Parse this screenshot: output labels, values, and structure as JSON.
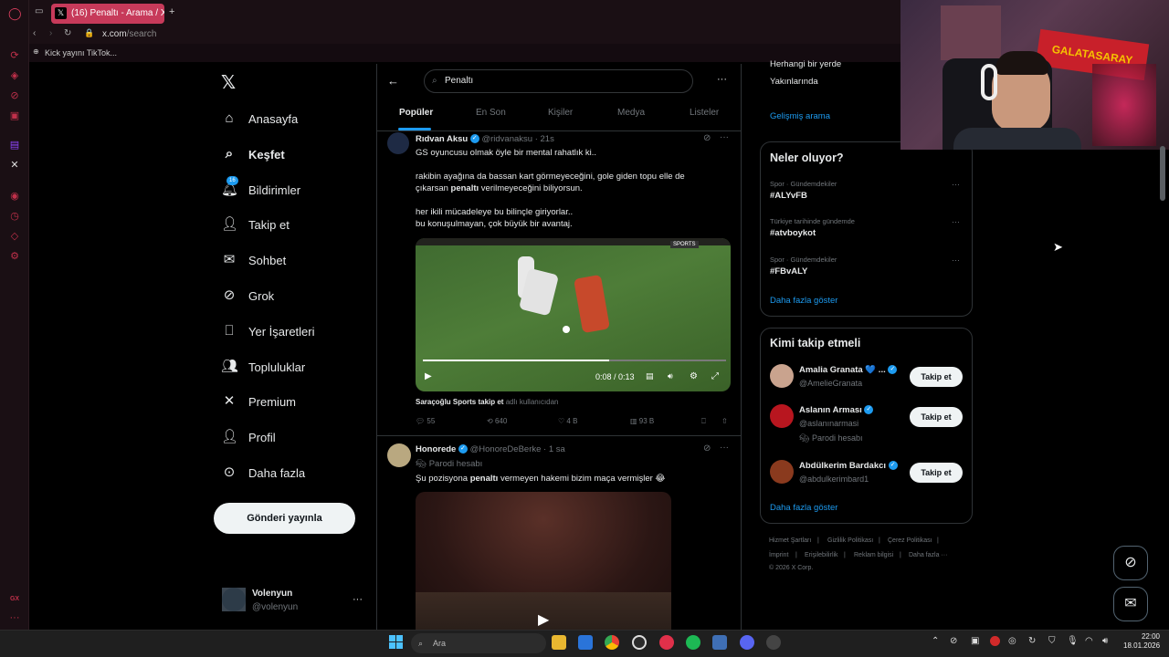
{
  "browser": {
    "tab_title": "(16) Penaltı - Arama / X",
    "tab_favicon": "𝕏",
    "new_tab": "+",
    "url_host": "x.com",
    "url_path": "/search",
    "bookmark": "Kick yayını TikTok..."
  },
  "nav": {
    "logo": "𝕏",
    "items": [
      {
        "label": "Anasayfa",
        "icon": "home-icon"
      },
      {
        "label": "Keşfet",
        "icon": "search-icon"
      },
      {
        "label": "Bildirimler",
        "icon": "bell-icon",
        "badge": "16"
      },
      {
        "label": "Takip et",
        "icon": "person-add-icon"
      },
      {
        "label": "Sohbet",
        "icon": "mail-icon"
      },
      {
        "label": "Grok",
        "icon": "grok-icon"
      },
      {
        "label": "Yer İşaretleri",
        "icon": "bookmark-icon"
      },
      {
        "label": "Topluluklar",
        "icon": "communities-icon"
      },
      {
        "label": "Premium",
        "icon": "x-icon"
      },
      {
        "label": "Profil",
        "icon": "profile-icon"
      },
      {
        "label": "Daha fazla",
        "icon": "more-circle-icon"
      }
    ],
    "post_button": "Gönderi yayınla",
    "account": {
      "name": "Volenyun",
      "handle": "@volenyun",
      "more": "···"
    }
  },
  "search": {
    "query": "Penaltı",
    "tabs": [
      "Popüler",
      "En Son",
      "Kişiler",
      "Medya",
      "Listeler"
    ],
    "more": "···"
  },
  "tweets": [
    {
      "name": "Rıdvan Aksu",
      "handle": "@ridvanaksu",
      "time": "· 21s",
      "lines": [
        "GS oyuncusu olmak öyle bir mental rahatlık ki..",
        "",
        "rakibin ayağına da bassan kart görmeyeceğini, gole giden topu elle de",
        "çıkarsan penaltı verilmeyeceğini biliyorsun.",
        "",
        "her ikili mücadeleye bu bilinçle giriyorlar..",
        "bu konuşulmayan, çok büyük bir avantaj."
      ],
      "video_time": "0:08 / 0:13",
      "video_watermark": "SPORTS",
      "source_name": "Saraçoğlu Sports takip et",
      "source_suffix": " adlı kullanıcıdan",
      "replies": "55",
      "retweets": "640",
      "likes": "4 B",
      "views": "93 B"
    },
    {
      "name": "Honorede",
      "handle": "@HonoreDeBerke",
      "time": "· 1 sa",
      "parody": "Parodi hesabı",
      "text_before": "Şu pozisyona ",
      "text_bold": "penaltı",
      "text_after": " vermeyen hakemi bizim maça vermişler 😂"
    }
  ],
  "right": {
    "location_options": [
      "Herhangi bir yerde",
      "Yakınlarında"
    ],
    "advanced_search": "Gelişmiş arama",
    "trends_title": "Neler oluyor?",
    "trends": [
      {
        "context": "Spor · Gündemdekiler",
        "tag": "#ALYvFB"
      },
      {
        "context": "Türkiye tarihinde gündemde",
        "tag": "#atvboykot"
      },
      {
        "context": "Spor · Gündemdekiler",
        "tag": "#FBvALY"
      }
    ],
    "show_more": "Daha fazla göster",
    "who_title": "Kimi takip etmeli",
    "who": [
      {
        "name": "Amalia Granata 💙 ...",
        "handle": "@AmelieGranata",
        "note": ""
      },
      {
        "name": "Aslanın Arması",
        "handle": "@aslanınarmasi",
        "note": "Parodi hesabı"
      },
      {
        "name": "Abdülkerim Bardakcı",
        "handle": "@abdulkerimbard1",
        "note": ""
      }
    ],
    "follow_label": "Takip et",
    "footer": [
      "Hizmet Şartları",
      "|",
      "Gizlilik Politikası",
      "|",
      "Çerez Politikası",
      "|",
      "İmprint",
      "|",
      "Erişilebilirlik",
      "|",
      "Reklam bilgisi",
      "|",
      "Daha fazla ···",
      "© 2026 X Corp."
    ]
  },
  "taskbar": {
    "search_placeholder": "Ara",
    "time": "22:00",
    "date": "18.01.2026"
  },
  "rail": {
    "gx_label": "GX",
    "more": "···"
  },
  "webcam_banner": "GALATASARAY"
}
